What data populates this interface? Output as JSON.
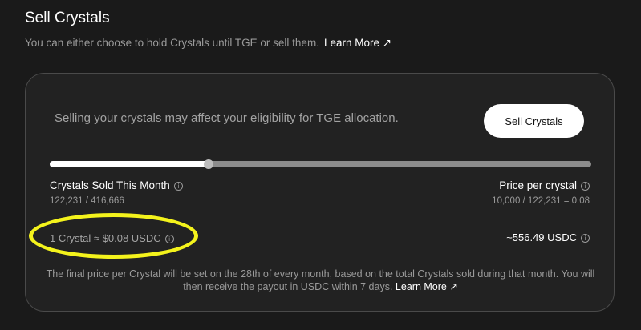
{
  "header": {
    "title": "Sell Crystals",
    "subtitle": "You can either choose to hold Crystals until TGE or sell them.",
    "learn_more": "Learn More ↗"
  },
  "card": {
    "warning": "Selling your crystals may affect your eligibility for TGE allocation.",
    "sell_button": "Sell Crystals",
    "progress_fraction": 0.293,
    "left_stat": {
      "label": "Crystals Sold This Month",
      "value": "122,231 / 416,666"
    },
    "right_stat": {
      "label": "Price per crystal",
      "value": "10,000 / 122,231 = 0.08"
    },
    "rate": "1 Crystal ≈ $0.08 USDC",
    "usdc_total": "~556.49 USDC",
    "info_glyph": "i",
    "note_text": "The final price per Crystal will be set on the 28th of every month, based on the total Crystals sold during that month. You will then receive the payout in USDC within 7 days.",
    "note_link": "Learn More ↗"
  },
  "colors": {
    "background": "#1a1a1a",
    "card": "#222222",
    "highlight": "#f4f31c"
  }
}
